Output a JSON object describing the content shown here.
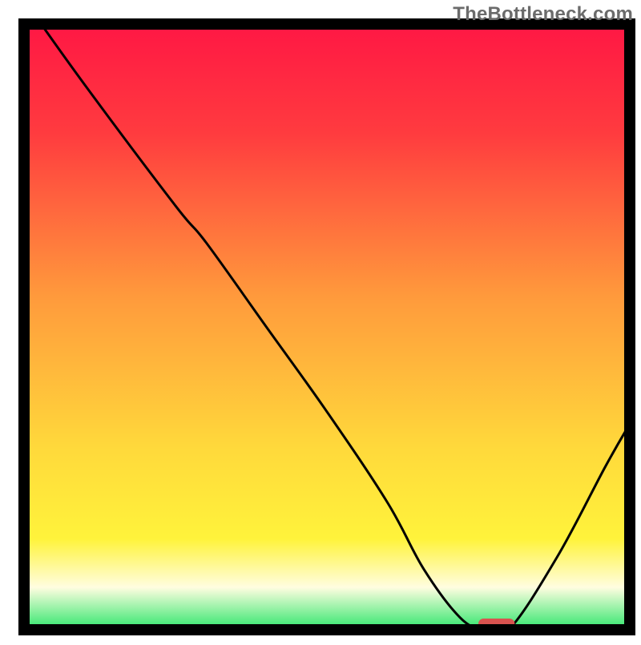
{
  "watermark": "TheBottleneck.com",
  "colors": {
    "border": "#000000",
    "curve": "#000000",
    "marker_fill": "#d9534f",
    "gradient_stops": [
      {
        "offset": 0.0,
        "color": "#ff1744"
      },
      {
        "offset": 0.18,
        "color": "#ff3b3f"
      },
      {
        "offset": 0.45,
        "color": "#ff9a3c"
      },
      {
        "offset": 0.7,
        "color": "#ffd93b"
      },
      {
        "offset": 0.85,
        "color": "#fff33b"
      },
      {
        "offset": 0.93,
        "color": "#fffde0"
      },
      {
        "offset": 1.0,
        "color": "#2ee66b"
      }
    ]
  },
  "chart_data": {
    "type": "line",
    "title": "",
    "xlabel": "",
    "ylabel": "",
    "xlim": [
      0,
      100
    ],
    "ylim": [
      0,
      100
    ],
    "series": [
      {
        "name": "bottleneck-curve",
        "x": [
          0,
          10,
          25,
          30,
          40,
          50,
          60,
          66,
          72,
          76,
          80,
          88,
          96,
          100
        ],
        "y": [
          104,
          90,
          70,
          64,
          50,
          36,
          21,
          10,
          2,
          0,
          0,
          12,
          27,
          34
        ]
      }
    ],
    "marker": {
      "name": "optimal-zone",
      "x_center": 78,
      "x_halfwidth": 3.0,
      "y": 1.0,
      "shape": "rounded-bar"
    },
    "annotations": []
  }
}
